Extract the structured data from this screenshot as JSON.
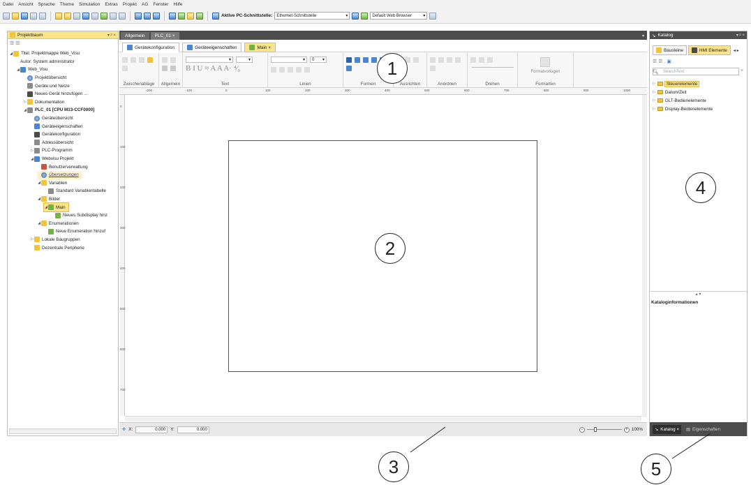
{
  "menu": [
    "Datei",
    "Ansicht",
    "Sprache",
    "Theme",
    "Simulation",
    "Extras",
    "Projekt",
    "AG",
    "Fenster",
    "Hilfe"
  ],
  "toolbar": {
    "pc_label": "Aktive PC-Schnittstelle:",
    "pc_value": "Ethernet-Schnittstelle",
    "browser_value": "Default Web Browser"
  },
  "left_panel": {
    "title": "Projektbaum",
    "controls": "▾ ᵖ ×",
    "tree": [
      {
        "label": "Titel:  Projektmappe Web_Visu",
        "indent": 0,
        "icon": "yel",
        "exp": "◢"
      },
      {
        "label": "Autor: System administrator",
        "indent": 1,
        "icon": "",
        "exp": ""
      },
      {
        "label": "Web_Visu",
        "indent": 1,
        "icon": "blue",
        "exp": "◢"
      },
      {
        "label": "Projektübersicht",
        "indent": 2,
        "icon": "globe",
        "exp": ""
      },
      {
        "label": "Geräte und Netze",
        "indent": 2,
        "icon": "gry",
        "exp": ""
      },
      {
        "label": "Neues Gerät hinzufügen ...",
        "indent": 2,
        "icon": "dk",
        "exp": ""
      },
      {
        "label": "Dokumentation",
        "indent": 2,
        "icon": "yel",
        "exp": "▷"
      },
      {
        "label": "PLC_01 [CPU M13-CCF0000]",
        "indent": 2,
        "icon": "gry",
        "exp": "◢",
        "bold": true
      },
      {
        "label": "Geräteübersicht",
        "indent": 3,
        "icon": "globe",
        "exp": ""
      },
      {
        "label": "Geräteeigenschaften",
        "indent": 3,
        "icon": "blue",
        "exp": ""
      },
      {
        "label": "Gerätekonfiguration",
        "indent": 3,
        "icon": "dk",
        "exp": ""
      },
      {
        "label": "Adressübersicht",
        "indent": 3,
        "icon": "gry",
        "exp": ""
      },
      {
        "label": "PLC-Programm",
        "indent": 3,
        "icon": "gry",
        "exp": "▷"
      },
      {
        "label": "Webvisu Projekt",
        "indent": 3,
        "icon": "blue",
        "exp": "◢"
      },
      {
        "label": "Benutzerverwaltung",
        "indent": 4,
        "icon": "red",
        "exp": ""
      },
      {
        "label": "Übersetzungen",
        "indent": 4,
        "icon": "globe",
        "exp": "",
        "uebers": true
      },
      {
        "label": "Variablen",
        "indent": 4,
        "icon": "yel",
        "exp": "◢"
      },
      {
        "label": "Standard Variablentabelle",
        "indent": 5,
        "icon": "gry",
        "exp": ""
      },
      {
        "label": "Bilder",
        "indent": 4,
        "icon": "yel",
        "exp": "◢"
      },
      {
        "label": "Main",
        "indent": 5,
        "icon": "grn",
        "exp": "◢",
        "sel": true
      },
      {
        "label": "Neues Subdisplay hinz",
        "indent": 6,
        "icon": "grn",
        "exp": ""
      },
      {
        "label": "Enumerationen",
        "indent": 4,
        "icon": "yel",
        "exp": "◢"
      },
      {
        "label": "Neue Enumeration hinzuf",
        "indent": 5,
        "icon": "grn",
        "exp": ""
      },
      {
        "label": "Lokale Baugruppen",
        "indent": 3,
        "icon": "yel",
        "exp": "▷"
      },
      {
        "label": "Dezentrale Peripherie",
        "indent": 3,
        "icon": "yel",
        "exp": ""
      }
    ]
  },
  "doc_tabs": [
    "Allgemein",
    "PLC_01 ×"
  ],
  "editor_tabs": [
    "Gerätekonfiguration",
    "Geräteeigenschaften",
    "Main ×"
  ],
  "ribbon": {
    "groups": [
      "Zwischenablage",
      "Allgemein",
      "Text",
      "Linien",
      "Formen",
      "Ausrichten",
      "Anordnen",
      "Drehen",
      "Formarten"
    ],
    "text_icons": "B I U ≈ A A A· ⁴⁄₀",
    "line_width": "0",
    "format_label": "Formatvorlagen"
  },
  "ruler": [
    "-200",
    "-100",
    "0",
    "100",
    "200",
    "300",
    "400",
    "500",
    "600",
    "700",
    "800",
    "900",
    "1000"
  ],
  "ruler_v": [
    "0",
    "100",
    "200",
    "300",
    "400",
    "500",
    "600",
    "700"
  ],
  "status": {
    "x_label": "X:",
    "x_value": "0.000",
    "y_label": "Y:",
    "y_value": "0.000",
    "zoom": "100%"
  },
  "right_panel": {
    "title": "Katalog",
    "controls": "▾ ᵖ ×",
    "tabs": [
      "Bausteine",
      "HMI Elemente"
    ],
    "search_placeholder": "SearchText",
    "items": [
      "Steuerelemente",
      "Datum/Zeit",
      "GLT-Bedienelemente",
      "Display-Bedienelemente"
    ],
    "info_title": "Kataloginformationen",
    "bottom_tabs": [
      "Katalog ×",
      "Eigenschaften"
    ]
  },
  "callouts": [
    "1",
    "2",
    "3",
    "4",
    "5"
  ],
  "colors": {
    "accent": "#fbe38a",
    "dark_bar": "#4d4d4d"
  }
}
